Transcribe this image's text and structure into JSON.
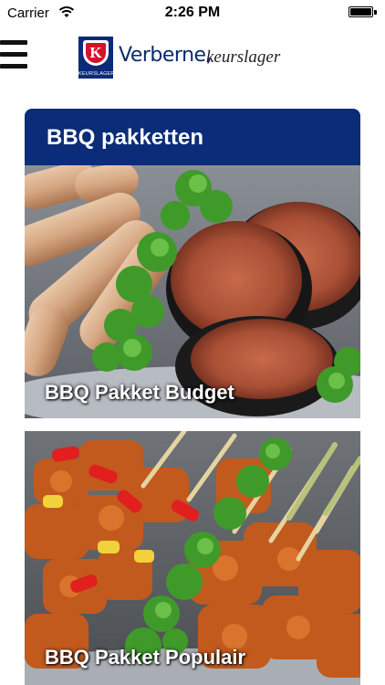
{
  "status_bar": {
    "carrier": "Carrier",
    "time": "2:26 PM",
    "wifi_icon": "wifi-icon",
    "battery_icon": "battery-icon"
  },
  "header": {
    "menu_icon": "hamburger-menu-icon",
    "logo": {
      "mark_letter": "K",
      "mark_caption": "KEURSLAGER",
      "brand": "Verberne,",
      "tagline": "keurslager"
    }
  },
  "section": {
    "title": "BBQ pakketten"
  },
  "packages": [
    {
      "label": "BBQ Pakket Budget"
    },
    {
      "label": "BBQ Pakket Populair"
    }
  ],
  "colors": {
    "header_blue": "#0b2c78",
    "logo_red": "#d6122b"
  }
}
